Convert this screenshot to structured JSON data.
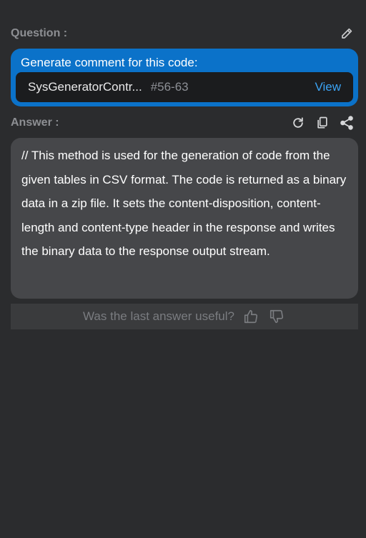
{
  "question": {
    "label": "Question :",
    "edit_icon": "pencil-icon",
    "prompt": "Generate comment for this code:",
    "code_ref": {
      "file": "SysGeneratorContr...",
      "range": "#56-63",
      "view_label": "View"
    }
  },
  "answer": {
    "label": "Answer :",
    "icons": [
      "refresh-icon",
      "copy-icon",
      "share-icon"
    ],
    "text": "// This method is used for the generation of code from the given tables in CSV format. The code is returned as a binary data in a zip file. It sets the content-disposition, content-length and content-type header in the response and writes the binary data to the response output stream."
  },
  "feedback": {
    "prompt": "Was the last answer useful?",
    "icons": [
      "thumbs-up-icon",
      "thumbs-down-icon"
    ]
  },
  "colors": {
    "background": "#2b2c2e",
    "question_card": "#0b72c9",
    "code_ref_bg": "#1b1c1e",
    "link": "#3ba3f4",
    "answer_card": "#46474a",
    "muted_text": "#8d8f93"
  }
}
